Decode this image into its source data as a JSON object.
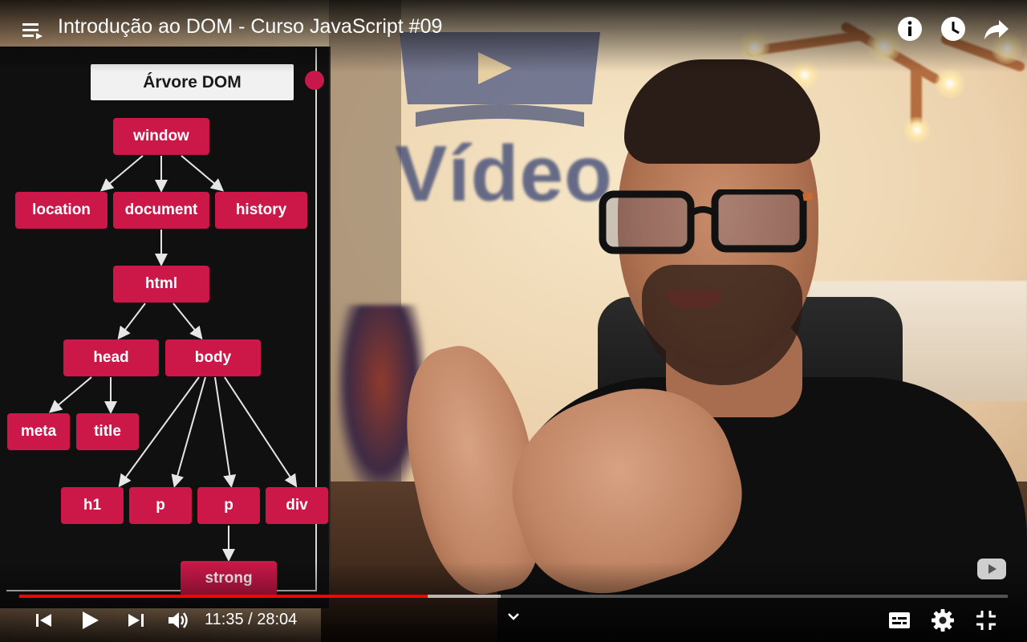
{
  "header": {
    "title": "Introdução ao DOM - Curso JavaScript #09"
  },
  "slide": {
    "title": "Árvore DOM",
    "nodes": {
      "window": "window",
      "location": "location",
      "document": "document",
      "history": "history",
      "html": "html",
      "head": "head",
      "body": "body",
      "meta": "meta",
      "title": "title",
      "h1": "h1",
      "p1": "p",
      "p2": "p",
      "div": "div",
      "strong": "strong"
    }
  },
  "scene": {
    "logo_text": "Vídeo"
  },
  "player": {
    "time": "11:35 / 28:04",
    "progress_played": 0.413,
    "progress_buffered": 0.487
  },
  "icons": {
    "playlist": "playlist-icon",
    "info": "info-icon",
    "watch_later": "clock-icon",
    "share": "share-icon",
    "previous": "skip-previous-icon",
    "play": "play-icon",
    "next": "skip-next-icon",
    "volume": "volume-icon",
    "chevron": "chevron-down-icon",
    "subtitles": "subtitles-icon",
    "settings": "gear-icon",
    "exit_fullscreen": "exit-fullscreen-icon",
    "watermark": "channel-watermark-icon"
  },
  "colors": {
    "accent": "#ff0000",
    "node": "#cb1849"
  }
}
